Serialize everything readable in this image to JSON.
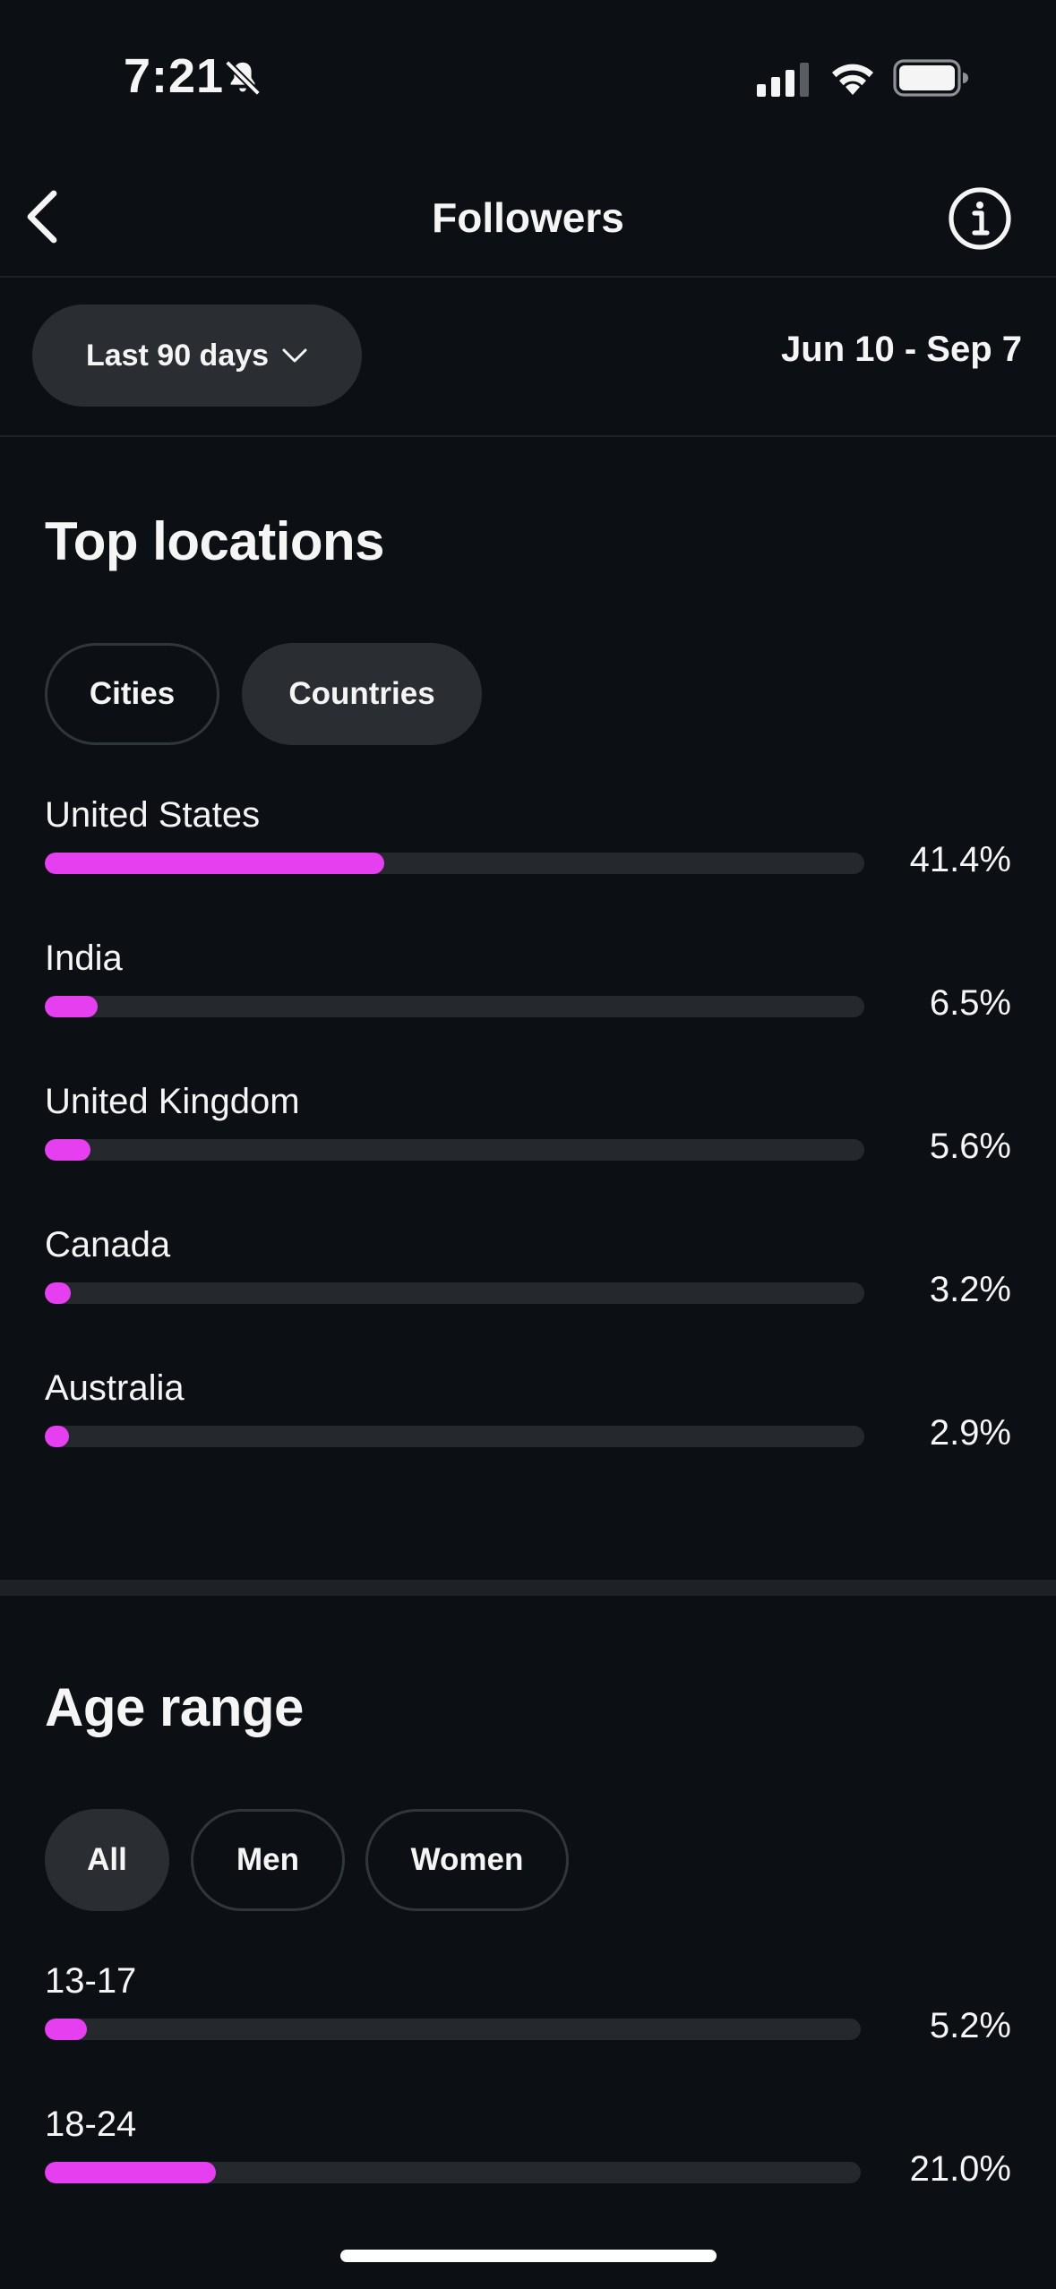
{
  "status_bar": {
    "time": "7:21"
  },
  "nav": {
    "title": "Followers"
  },
  "filter": {
    "range_label": "Last 90 days",
    "date_range": "Jun 10 - Sep 7"
  },
  "top_locations": {
    "title": "Top locations",
    "tabs": [
      {
        "label": "Cities",
        "active": false
      },
      {
        "label": "Countries",
        "active": true
      }
    ],
    "rows": [
      {
        "label": "United States",
        "value": "41.4%",
        "fraction": 0.414
      },
      {
        "label": "India",
        "value": "6.5%",
        "fraction": 0.065
      },
      {
        "label": "United Kingdom",
        "value": "5.6%",
        "fraction": 0.056
      },
      {
        "label": "Canada",
        "value": "3.2%",
        "fraction": 0.032
      },
      {
        "label": "Australia",
        "value": "2.9%",
        "fraction": 0.029
      }
    ]
  },
  "age_range": {
    "title": "Age range",
    "tabs": [
      {
        "label": "All",
        "active": true
      },
      {
        "label": "Men",
        "active": false
      },
      {
        "label": "Women",
        "active": false
      }
    ],
    "rows": [
      {
        "label": "13-17",
        "value": "5.2%",
        "fraction": 0.052
      },
      {
        "label": "18-24",
        "value": "21.0%",
        "fraction": 0.21
      }
    ]
  },
  "colors": {
    "background": "#0c1014",
    "accent": "#e53ff0",
    "track": "#25292d",
    "pill_active": "#2a2e33"
  }
}
